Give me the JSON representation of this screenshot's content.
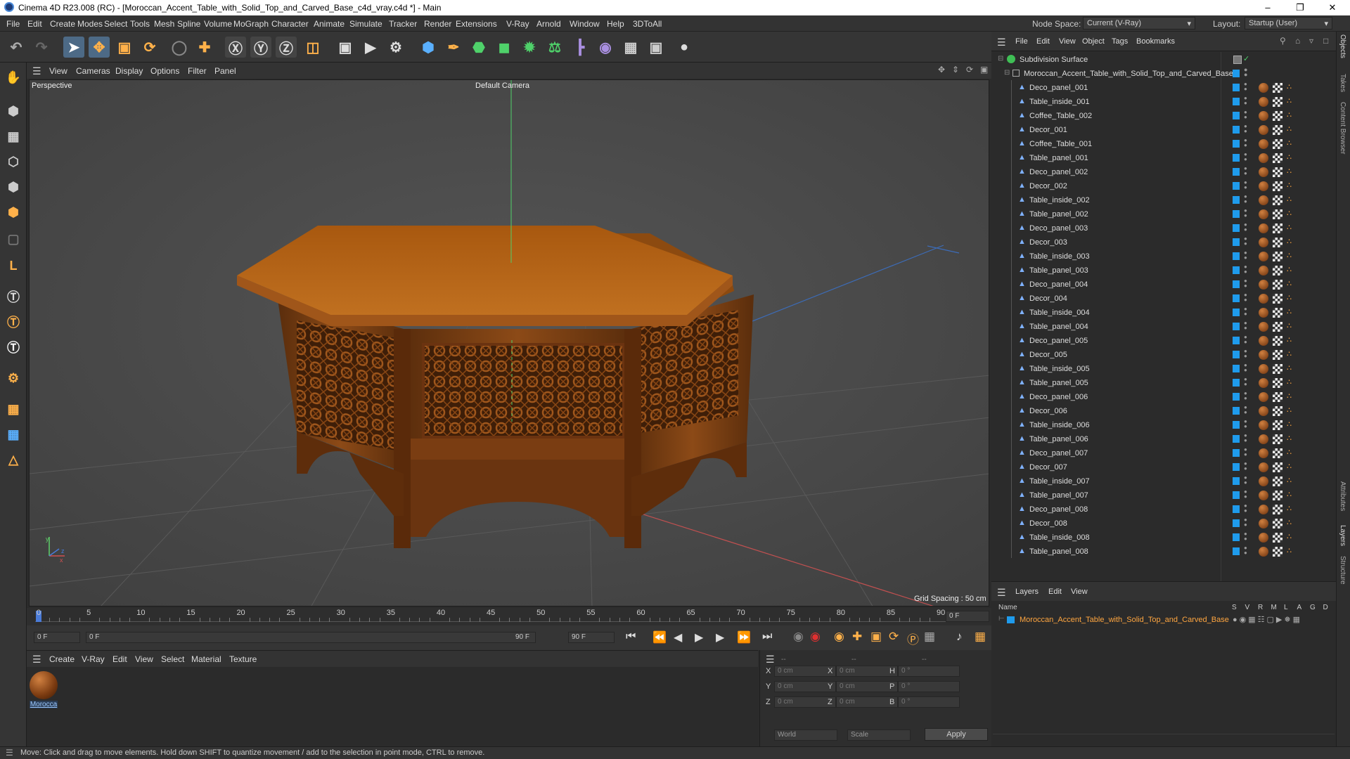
{
  "window": {
    "title": "Cinema 4D R23.008 (RC) - [Moroccan_Accent_Table_with_Solid_Top_and_Carved_Base_c4d_vray.c4d *] - Main"
  },
  "menu": [
    "File",
    "Edit",
    "Create",
    "Modes",
    "Select",
    "Tools",
    "Mesh",
    "Spline",
    "Volume",
    "MoGraph",
    "Character",
    "Animate",
    "Simulate",
    "Tracker",
    "Render",
    "Extensions",
    "V-Ray",
    "Arnold",
    "Window",
    "Help",
    "3DToAll"
  ],
  "nodespace": {
    "label": "Node Space:",
    "value": "Current (V-Ray)"
  },
  "layout": {
    "label": "Layout:",
    "value": "Startup (User)"
  },
  "viewport": {
    "menu": [
      "View",
      "Cameras",
      "Display",
      "Options",
      "Filter",
      "Panel"
    ],
    "name": "Perspective",
    "camera": "Default Camera",
    "grid_spacing": "Grid Spacing : 50 cm"
  },
  "timeline": {
    "ticks": [
      "0",
      "5",
      "10",
      "15",
      "20",
      "25",
      "30",
      "35",
      "40",
      "45",
      "50",
      "55",
      "60",
      "65",
      "70",
      "75",
      "80",
      "85",
      "90"
    ],
    "end_field": "0 F"
  },
  "transport": {
    "start": "0 F",
    "range_start": "0 F",
    "range_end": "90 F",
    "end": "90 F"
  },
  "material_menu": [
    "Create",
    "V-Ray",
    "Edit",
    "View",
    "Select",
    "Material",
    "Texture"
  ],
  "material": {
    "name": "Morocca"
  },
  "coords": {
    "header": [
      "--",
      "--",
      "--"
    ],
    "rows": [
      {
        "a": "X",
        "av": "0 cm",
        "b": "X",
        "bv": "0 cm",
        "c": "H",
        "cv": "0 °"
      },
      {
        "a": "Y",
        "av": "0 cm",
        "b": "Y",
        "bv": "0 cm",
        "c": "P",
        "cv": "0 °"
      },
      {
        "a": "Z",
        "av": "0 cm",
        "b": "Z",
        "bv": "0 cm",
        "c": "B",
        "cv": "0 °"
      }
    ],
    "world": "World",
    "scale": "Scale",
    "apply": "Apply"
  },
  "object_manager": {
    "menu": [
      "File",
      "Edit",
      "View",
      "Object",
      "Tags",
      "Bookmarks"
    ],
    "root": "Subdivision Surface",
    "group": "Moroccan_Accent_Table_with_Solid_Top_and_Carved_Base",
    "children": [
      "Deco_panel_001",
      "Table_inside_001",
      "Coffee_Table_002",
      "Decor_001",
      "Coffee_Table_001",
      "Table_panel_001",
      "Deco_panel_002",
      "Decor_002",
      "Table_inside_002",
      "Table_panel_002",
      "Deco_panel_003",
      "Decor_003",
      "Table_inside_003",
      "Table_panel_003",
      "Deco_panel_004",
      "Decor_004",
      "Table_inside_004",
      "Table_panel_004",
      "Deco_panel_005",
      "Decor_005",
      "Table_inside_005",
      "Table_panel_005",
      "Deco_panel_006",
      "Decor_006",
      "Table_inside_006",
      "Table_panel_006",
      "Deco_panel_007",
      "Decor_007",
      "Table_inside_007",
      "Table_panel_007",
      "Deco_panel_008",
      "Decor_008",
      "Table_inside_008",
      "Table_panel_008"
    ]
  },
  "layers": {
    "menu": [
      "Layers",
      "Edit",
      "View"
    ],
    "col_name": "Name",
    "cols": [
      "S",
      "V",
      "R",
      "M",
      "L",
      "A",
      "G",
      "D"
    ],
    "row": "Moroccan_Accent_Table_with_Solid_Top_and_Carved_Base"
  },
  "right_tabs": [
    "Objects",
    "Takes",
    "Content Browser",
    "Attributes",
    "Layers",
    "Structure"
  ],
  "status": "Move: Click and drag to move elements. Hold down SHIFT to quantize movement / add to the selection in point mode, CTRL to remove.",
  "colors": {
    "accent": "#4aa3df",
    "wood": "#b8651c",
    "bg": "#2b2b2b"
  }
}
